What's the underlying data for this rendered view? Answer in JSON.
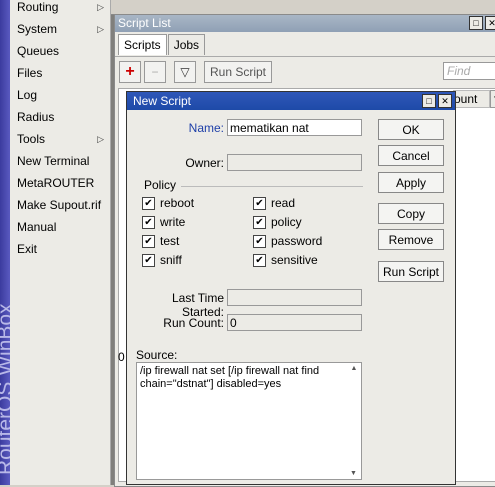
{
  "brand": {
    "text": "RouterOS WinBox"
  },
  "side_menu": {
    "items": [
      {
        "label": "Routing",
        "has_submenu": true
      },
      {
        "label": "System",
        "has_submenu": true
      },
      {
        "label": "Queues",
        "has_submenu": false
      },
      {
        "label": "Files",
        "has_submenu": false
      },
      {
        "label": "Log",
        "has_submenu": false
      },
      {
        "label": "Radius",
        "has_submenu": false
      },
      {
        "label": "Tools",
        "has_submenu": true
      },
      {
        "label": "New Terminal",
        "has_submenu": false
      },
      {
        "label": "MetaROUTER",
        "has_submenu": false
      },
      {
        "label": "Make Supout.rif",
        "has_submenu": false
      },
      {
        "label": "Manual",
        "has_submenu": false
      },
      {
        "label": "Exit",
        "has_submenu": false
      }
    ]
  },
  "script_list": {
    "title": "Script List",
    "tabs": [
      "Scripts",
      "Jobs"
    ],
    "active_tab": "Scripts",
    "toolbar": {
      "add_symbol": "+",
      "remove_symbol": "−",
      "filter_symbol": "▽",
      "run_script_label": "Run Script"
    },
    "find_placeholder": "Find",
    "column_header_fragment": "ount",
    "row_count_fragment": "0"
  },
  "new_script": {
    "title": "New Script",
    "name_label": "Name:",
    "name_value": "mematikan nat",
    "owner_label": "Owner:",
    "owner_value": "",
    "policy_label": "Policy",
    "policies": {
      "reboot": {
        "label": "reboot",
        "checked": true
      },
      "read": {
        "label": "read",
        "checked": true
      },
      "write": {
        "label": "write",
        "checked": true
      },
      "policy": {
        "label": "policy",
        "checked": true
      },
      "test": {
        "label": "test",
        "checked": true
      },
      "password": {
        "label": "password",
        "checked": true
      },
      "sniff": {
        "label": "sniff",
        "checked": true
      },
      "sensitive": {
        "label": "sensitive",
        "checked": true
      }
    },
    "last_time_started_label": "Last Time Started:",
    "last_time_started_value": "",
    "run_count_label": "Run Count:",
    "run_count_value": "0",
    "source_label": "Source:",
    "source_line1": "/ip firewall nat set [/ip firewall nat find",
    "source_line2": "chain=\"dstnat\"] disabled=yes",
    "buttons": {
      "ok": "OK",
      "cancel": "Cancel",
      "apply": "Apply",
      "copy": "Copy",
      "remove": "Remove",
      "run_script": "Run Script"
    }
  },
  "colors": {
    "dialog_title_bg": "#1e4aa8",
    "inactive_title_bg": "#8fa0b5",
    "add_button_red": "#cc0000"
  }
}
